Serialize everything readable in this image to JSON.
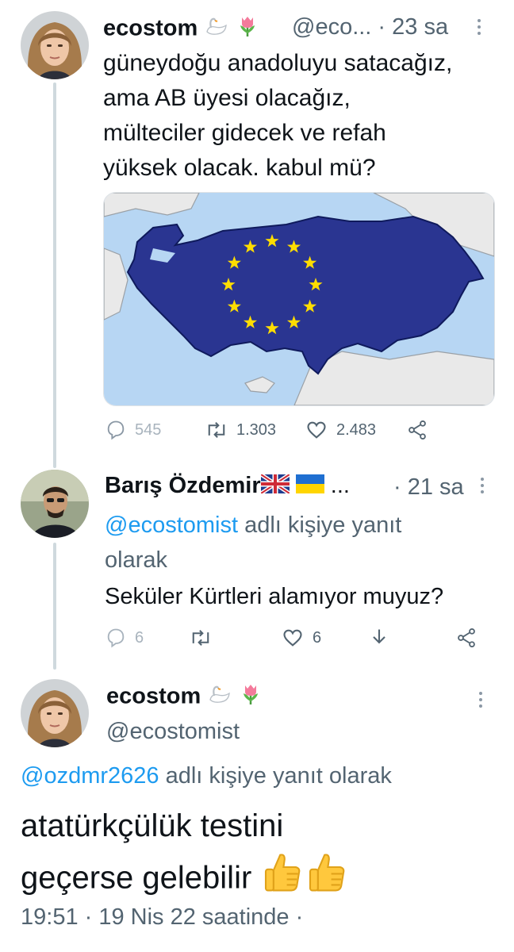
{
  "tweet1": {
    "display_name": "ecostom",
    "handle_time": "@eco... · 23 sa",
    "text_lines": [
      "güneydoğu anadoluyu satacağız,",
      "ama AB üyesi olacağız,",
      "mülteciler gidecek ve refah",
      "yüksek olacak. kabul mü?"
    ],
    "stats": {
      "replies": "545",
      "retweets": "1.303",
      "likes": "2.483"
    }
  },
  "tweet2": {
    "display_name": "Barış Özdemir",
    "ellipsis": "...",
    "time": "· 21 sa",
    "reply_to_handle": "@ecostomist",
    "reply_to_suffix": " adlı kişiye yanıt",
    "reply_to_line2": "olarak",
    "text": "Seküler Kürtleri alamıyor muyuz?",
    "stats": {
      "replies": "6",
      "likes": "6"
    }
  },
  "tweet3": {
    "display_name": "ecostom",
    "handle": "@ecostomist",
    "reply_to_handle": "@ozdmr2626",
    "reply_to_suffix": " adlı kişiye yanıt olarak",
    "text_lines": [
      "atatürkçülük testini",
      "geçerse gelebilir"
    ],
    "timestamp": "19:51 · 19 Nis 22 saatinde ·"
  },
  "colors": {
    "link": "#1d9bf0",
    "meta": "#536471",
    "thread_line": "#cfd9de",
    "map_blue": "#2a3591",
    "star_yellow": "#ffdd00"
  },
  "icons": [
    "reply-icon",
    "retweet-icon",
    "like-icon",
    "share-icon",
    "download-icon",
    "kebab-icon",
    "swan-emoji",
    "tulip-emoji",
    "uk-flag-emoji",
    "ukraine-flag-emoji",
    "thumbs-up-emoji"
  ]
}
